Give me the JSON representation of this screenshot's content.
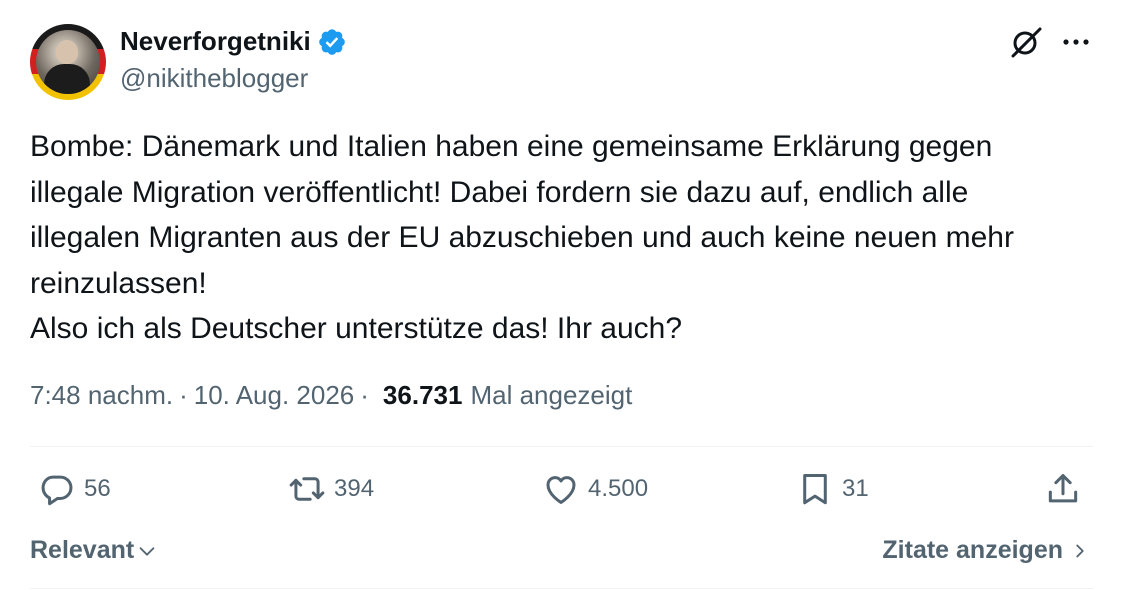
{
  "author": {
    "display_name": "Neverforgetniki",
    "handle": "@nikitheblogger",
    "verified": true,
    "badge_color": "#1d9bf0"
  },
  "tweet": {
    "text": "Bombe: Dänemark und Italien haben eine gemeinsame Erklärung gegen\nillegale Migration veröffentlicht! Dabei fordern sie dazu auf, endlich alle\nillegalen Migranten aus der EU abzuschieben und auch keine neuen mehr\nreinzulassen!\nAlso ich als Deutscher unterstütze das! Ihr auch?"
  },
  "meta": {
    "time": "7:48 nachm.",
    "separator": "·",
    "date": "10. Aug. 2026",
    "views_count": "36.731",
    "views_label": "Mal angezeigt"
  },
  "actions": {
    "replies": "56",
    "reposts": "394",
    "likes": "4.500",
    "bookmarks": "31"
  },
  "footer": {
    "sort_label": "Relevant",
    "quotes_label": "Zitate anzeigen"
  },
  "icons": [
    "grok-icon",
    "more-icon",
    "verified-badge-icon",
    "reply-icon",
    "repost-icon",
    "like-icon",
    "bookmark-icon",
    "share-icon",
    "chevron-down-icon",
    "chevron-right-icon"
  ],
  "colors": {
    "text": "#0f1419",
    "secondary": "#536471",
    "divider": "#eff3f4",
    "accent": "#1d9bf0"
  }
}
